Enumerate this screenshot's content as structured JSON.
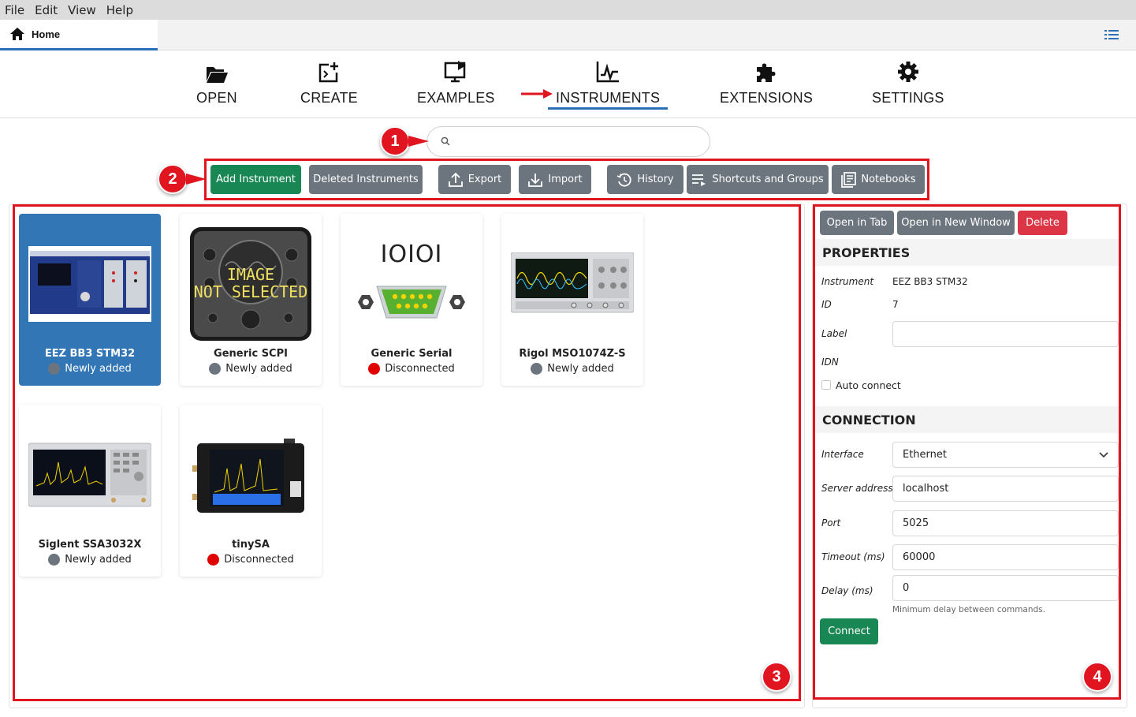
{
  "menubar": {
    "items": [
      "File",
      "Edit",
      "View",
      "Help"
    ]
  },
  "tabs": {
    "home_label": "Home"
  },
  "nav": {
    "open": "OPEN",
    "create": "CREATE",
    "examples": "EXAMPLES",
    "instruments": "INSTRUMENTS",
    "extensions": "EXTENSIONS",
    "settings": "SETTINGS",
    "active": "INSTRUMENTS"
  },
  "search": {
    "value": "",
    "placeholder": ""
  },
  "toolbar": {
    "add_instrument": "Add Instrument",
    "deleted_instruments": "Deleted Instruments",
    "export": "Export",
    "import": "Import",
    "history": "History",
    "shortcuts_groups": "Shortcuts and Groups",
    "notebooks": "Notebooks"
  },
  "instruments": [
    {
      "name": "EEZ BB3 STM32",
      "status": "Newly added",
      "status_color": "#6c757d",
      "selected": true
    },
    {
      "name": "Generic SCPI",
      "status": "Newly added",
      "status_color": "#6c757d",
      "image_text_1": "IMAGE",
      "image_text_2": "NOT SELECTED"
    },
    {
      "name": "Generic Serial",
      "status": "Disconnected",
      "status_color": "#e00000",
      "image_text_1": "IOIOI"
    },
    {
      "name": "Rigol MSO1074Z-S",
      "status": "Newly added",
      "status_color": "#6c757d"
    },
    {
      "name": "Siglent SSA3032X",
      "status": "Newly added",
      "status_color": "#6c757d"
    },
    {
      "name": "tinySA",
      "status": "Disconnected",
      "status_color": "#e00000"
    }
  ],
  "details": {
    "open_in_tab": "Open in Tab",
    "open_in_new_window": "Open in New Window",
    "delete": "Delete",
    "properties_title": "PROPERTIES",
    "instrument_label": "Instrument",
    "instrument_value": "EEZ BB3 STM32",
    "id_label": "ID",
    "id_value": "7",
    "label_label": "Label",
    "label_value": "",
    "idn_label": "IDN",
    "auto_connect_label": "Auto connect",
    "auto_connect_checked": false,
    "connection_title": "CONNECTION",
    "interface_label": "Interface",
    "interface_value": "Ethernet",
    "server_address_label": "Server address",
    "server_address_value": "localhost",
    "port_label": "Port",
    "port_value": "5025",
    "timeout_label": "Timeout (ms)",
    "timeout_value": "60000",
    "delay_label": "Delay (ms)",
    "delay_value": "0",
    "delay_hint": "Minimum delay between commands.",
    "connect": "Connect"
  },
  "annotations": {
    "m1": "1",
    "m2": "2",
    "m3": "3",
    "m4": "4"
  },
  "colors": {
    "accent": "#2b6fb6",
    "selected_card": "#3376b5",
    "success": "#198754",
    "danger": "#dc3545",
    "secondary": "#6c757d",
    "annotation": "#e0151f"
  }
}
